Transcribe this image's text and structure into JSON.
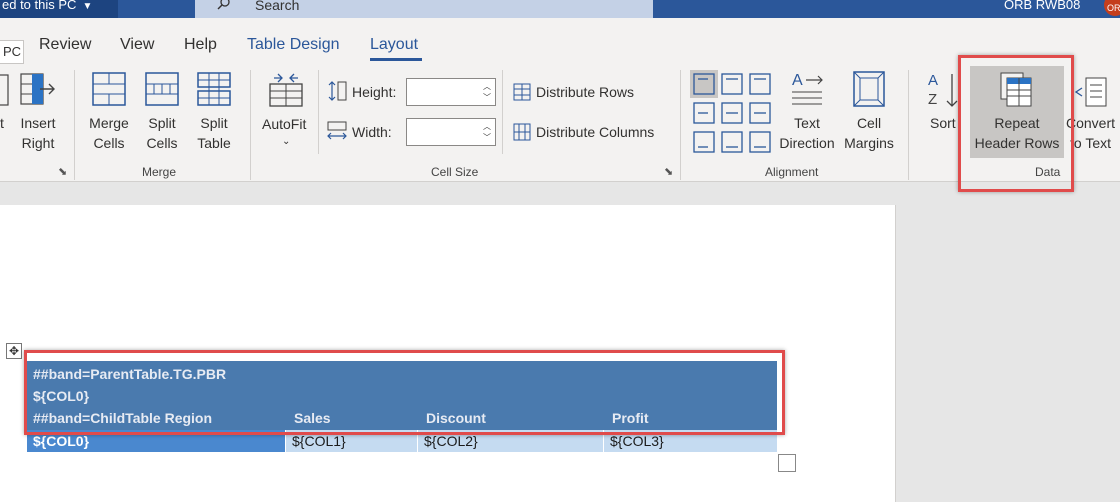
{
  "titlebar": {
    "save_status": "ed to this PC",
    "search_placeholder": "Search",
    "user_name": "ORB RWB08",
    "avatar_initials": "OR"
  },
  "tabs": {
    "cut_tab": "PC",
    "items": [
      "Review",
      "View",
      "Help",
      "Table Design",
      "Layout"
    ],
    "active": "Layout"
  },
  "ribbon": {
    "rows_columns": {
      "insert_left_partial": "t",
      "insert_right_line1": "Insert",
      "insert_right_line2": "Right"
    },
    "merge": {
      "label": "Merge",
      "merge_cells_line1": "Merge",
      "merge_cells_line2": "Cells",
      "split_cells_line1": "Split",
      "split_cells_line2": "Cells",
      "split_table_line1": "Split",
      "split_table_line2": "Table"
    },
    "cell_size": {
      "label": "Cell Size",
      "autofit": "AutoFit",
      "height_label": "Height:",
      "width_label": "Width:",
      "height_value": "",
      "width_value": "",
      "distribute_rows": "Distribute Rows",
      "distribute_columns": "Distribute Columns"
    },
    "alignment": {
      "label": "Alignment",
      "text_direction_line1": "Text",
      "text_direction_line2": "Direction",
      "cell_margins_line1": "Cell",
      "cell_margins_line2": "Margins"
    },
    "data": {
      "label": "Data",
      "sort": "Sort",
      "repeat_header_line1": "Repeat",
      "repeat_header_line2": "Header Rows",
      "convert_line1": "Convert",
      "convert_line2": "to Text"
    }
  },
  "document": {
    "header_rows": [
      "##band=ParentTable.TG.PBR",
      "${COL0}",
      "##band=ChildTable Region"
    ],
    "header_columns": [
      "Sales",
      "Discount",
      "Profit"
    ],
    "data_row": [
      "${COL0}",
      "${COL1}",
      "${COL2}",
      "${COL3}"
    ]
  },
  "colors": {
    "accent": "#2b579a",
    "highlight_box": "#e04b4b",
    "table_header": "#4a7aae",
    "table_row_first": "#4a88cf",
    "table_row_rest": "#c5dbf1"
  }
}
